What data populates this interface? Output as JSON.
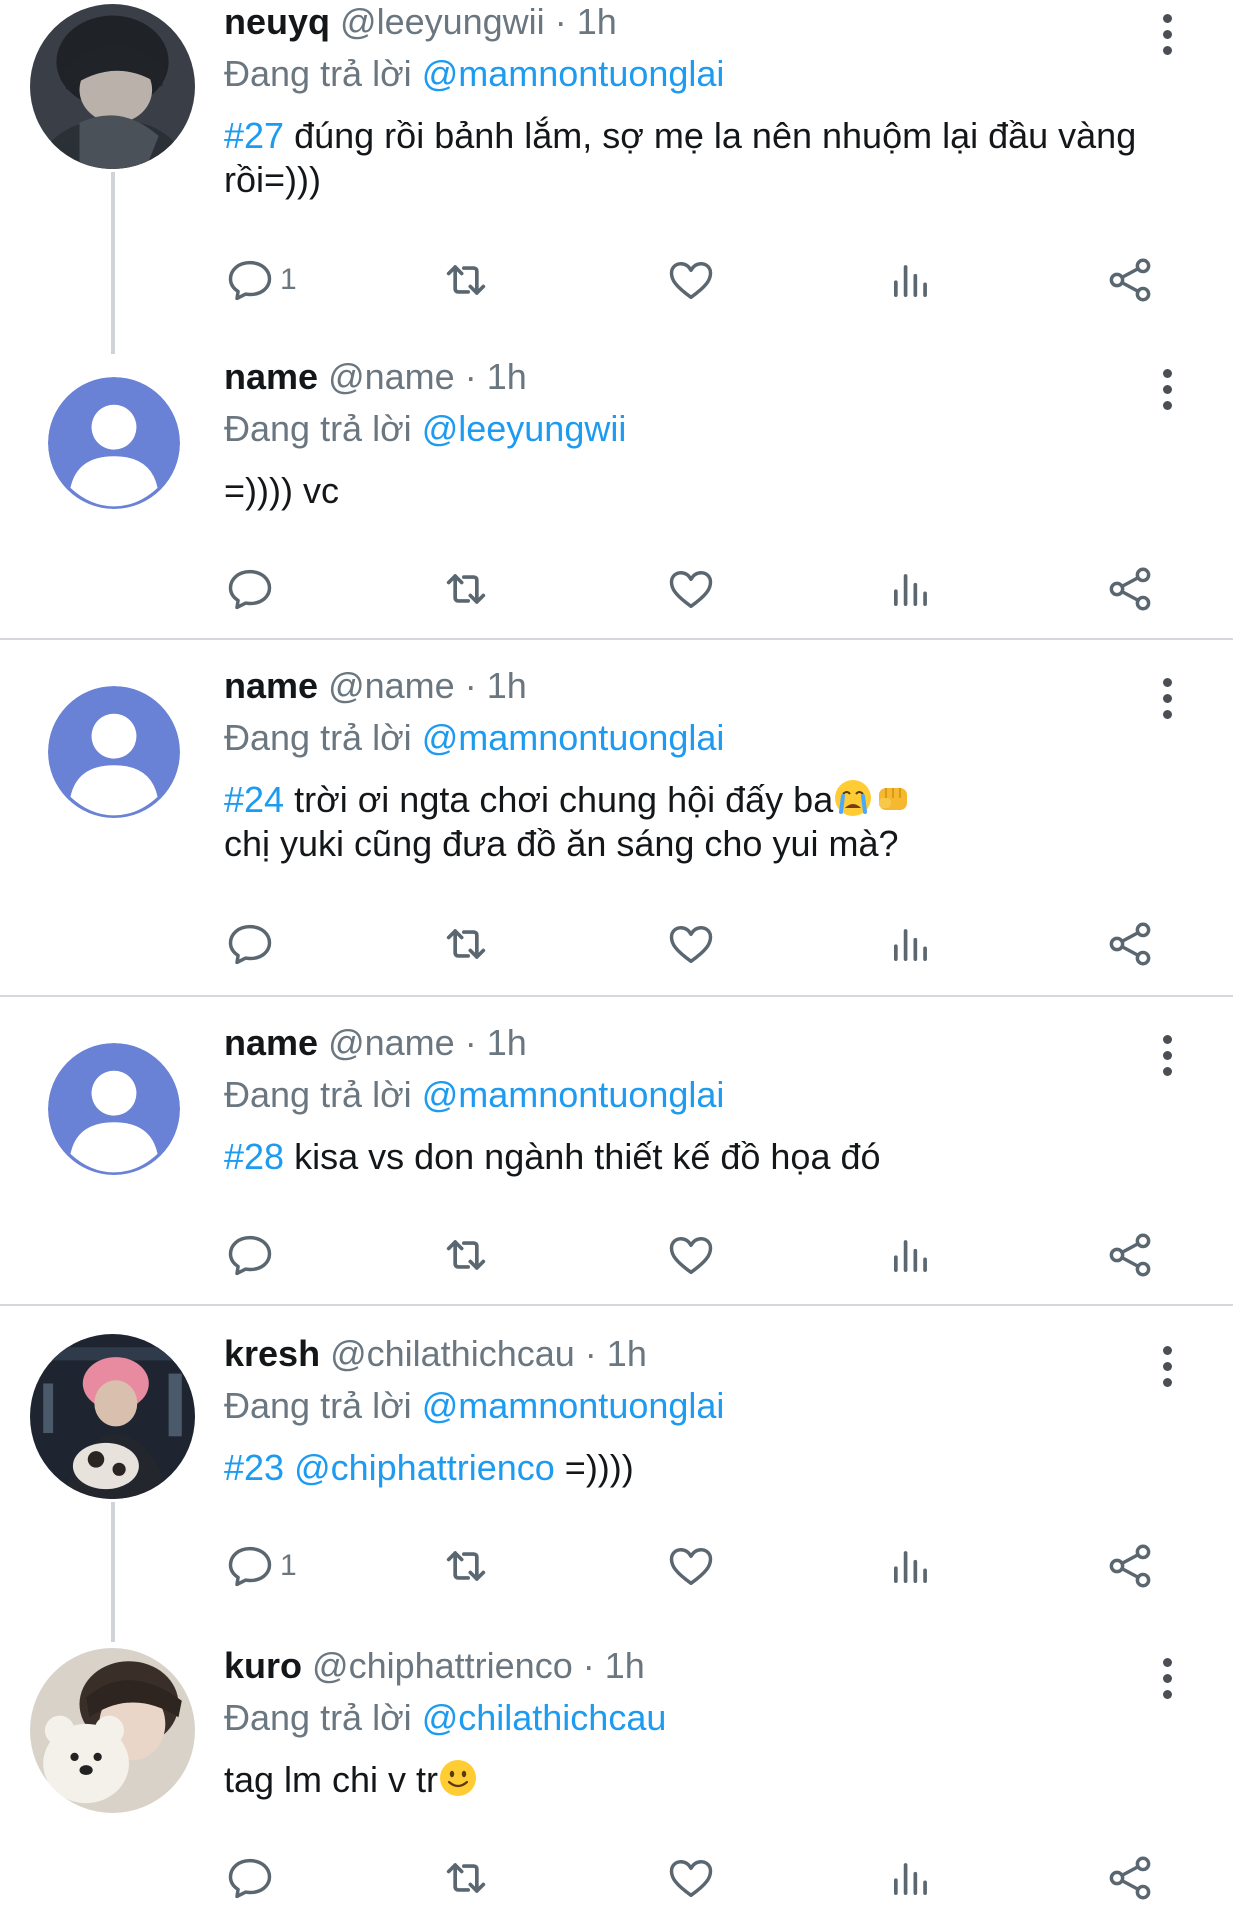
{
  "reply_prefix": "Đang trả lời",
  "icons": {
    "reply": "reply-icon",
    "retweet": "retweet-icon",
    "like": "heart-icon",
    "views": "views-icon",
    "share": "share-icon",
    "more": "more-vertical-icon"
  },
  "colors": {
    "link": "#1d9bf0",
    "muted": "#6b7780",
    "default_avatar": "#6a82d6"
  },
  "tweets": [
    {
      "name": "neuyq",
      "handle": "@leeyungwii",
      "time": "1h",
      "reply_to": "@mamnontuonglai",
      "hashtag": "#27",
      "text": "đúng rồi bảnh lắm, sợ mẹ la nên nhuộm lại đầu vàng rồi=)))",
      "reply_count": "1",
      "avatar": "photo-avatar-dark-hair"
    },
    {
      "name": "name",
      "handle": "@name",
      "time": "1h",
      "reply_to": "@leeyungwii",
      "hashtag": "",
      "text": "=)))) vc",
      "reply_count": "",
      "avatar": "default-avatar"
    },
    {
      "name": "name",
      "handle": "@name",
      "time": "1h",
      "reply_to": "@mamnontuonglai",
      "hashtag": "#24",
      "text": "trời ơi ngta chơi chung hội đấy ba",
      "text2": "chị yuki cũng đưa đồ ăn sáng cho yui mà?",
      "emojis": [
        "crying-face-emoji",
        "fist-emoji"
      ],
      "reply_count": "",
      "avatar": "default-avatar"
    },
    {
      "name": "name",
      "handle": "@name",
      "time": "1h",
      "reply_to": "@mamnontuonglai",
      "hashtag": "#28",
      "text": "kisa vs don ngành thiết kế đồ họa đó",
      "reply_count": "",
      "avatar": "default-avatar"
    },
    {
      "name": "kresh",
      "handle": "@chilathichcau",
      "time": "1h",
      "reply_to": "@mamnontuonglai",
      "hashtag": "#23",
      "mention": "@chiphattrienco",
      "text": "=))))",
      "reply_count": "1",
      "avatar": "photo-avatar-pink-hair"
    },
    {
      "name": "kuro",
      "handle": "@chiphattrienco",
      "time": "1h",
      "reply_to": "@chilathichcau",
      "hashtag": "",
      "text": "tag lm chi v tr",
      "emojis": [
        "slightly-smiling-face-emoji"
      ],
      "reply_count": "",
      "avatar": "photo-avatar-bear-plush"
    }
  ]
}
